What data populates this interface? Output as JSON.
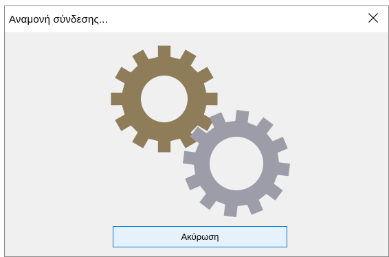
{
  "window": {
    "title": "Αναμονή σύνδεσης..."
  },
  "icons": {
    "close": "close-icon",
    "gear_large": "gear-icon",
    "gear_small": "gear-icon"
  },
  "colors": {
    "gear_large": "#8f7c58",
    "gear_small": "#9d9da9",
    "button_border": "#0078d7",
    "button_bg": "#e5f1fb",
    "dialog_bg": "#f0f0f0"
  },
  "actions": {
    "cancel_label": "Ακύρωση"
  }
}
